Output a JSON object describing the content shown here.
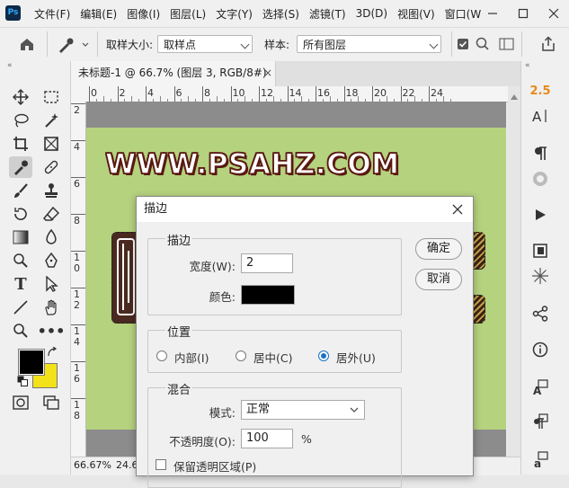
{
  "app": {
    "logo": "Ps"
  },
  "menu": [
    "文件(F)",
    "编辑(E)",
    "图像(I)",
    "图层(L)",
    "文字(Y)",
    "选择(S)",
    "滤镜(T)",
    "3D(D)",
    "视图(V)",
    "窗口(W"
  ],
  "options": {
    "sample_size_label": "取样大小:",
    "sample_size_value": "取样点",
    "sample_label": "样本:",
    "sample_value": "所有图层"
  },
  "document": {
    "tab_title": "未标题-1 @ 66.7% (图层 3, RGB/8#) *",
    "tab_close": "×",
    "zoom": "66.67%",
    "status_partial": "24.6",
    "canvas_text": "WWW.PSAHZ.COM",
    "canvas_color": "#b5d27e"
  },
  "rulers": {
    "h_ticks": [
      "0",
      "2",
      "4",
      "6",
      "8",
      "10",
      "12",
      "14",
      "16",
      "18",
      "20",
      "22",
      "24"
    ],
    "v_ticks": [
      "2",
      "4",
      "6",
      "8",
      "1\n0",
      "1\n2",
      "1\n4",
      "1\n6",
      "1\n8"
    ]
  },
  "panel": {
    "char_size": "2.5"
  },
  "colors": {
    "foreground": "#000000",
    "background": "#f2e21a"
  },
  "dialog": {
    "title": "描边",
    "stroke_group": "描边",
    "width_label": "宽度(W):",
    "width_value": "2",
    "color_label": "颜色:",
    "stroke_color": "#000000",
    "ok_label": "确定",
    "cancel_label": "取消",
    "position_group": "位置",
    "positions": [
      "内部(I)",
      "居中(C)",
      "居外(U)"
    ],
    "selected_position": "居外(U)",
    "blend_group": "混合",
    "mode_label": "模式:",
    "mode_value": "正常",
    "opacity_label": "不透明度(O):",
    "opacity_value": "100",
    "opacity_unit": "%",
    "preserve_label": "保留透明区域(P)"
  }
}
